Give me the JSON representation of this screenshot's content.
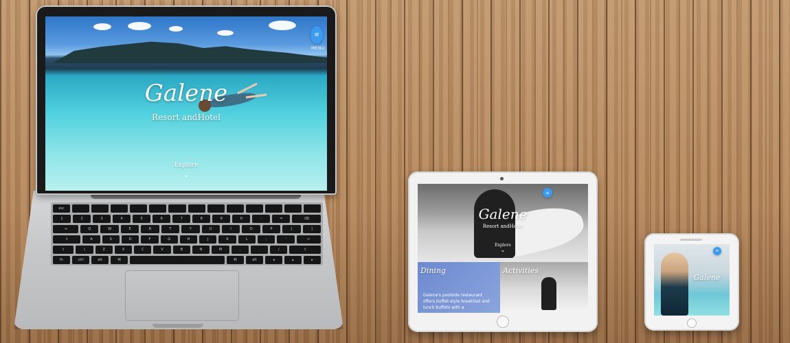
{
  "laptop": {
    "brand": "Galene",
    "subtitle": "Resort andHotel",
    "menu_label": "MENU",
    "explore_label": "Explore",
    "menu_icon": "hamburger-icon",
    "chevron_icon": "chevron-down-icon"
  },
  "tablet": {
    "brand": "Galene",
    "subtitle": "Resort andHotel",
    "explore_label": "Explore",
    "panels": [
      {
        "title": "Dining",
        "text": "Galene's poolside restaurant offers buffet-style breakfast and lunch buffets with a"
      },
      {
        "title": "Activities"
      }
    ]
  },
  "phone": {
    "brand": "Galene"
  },
  "colors": {
    "accent_blue": "#3a9bf0",
    "wood": "#b98d62"
  }
}
